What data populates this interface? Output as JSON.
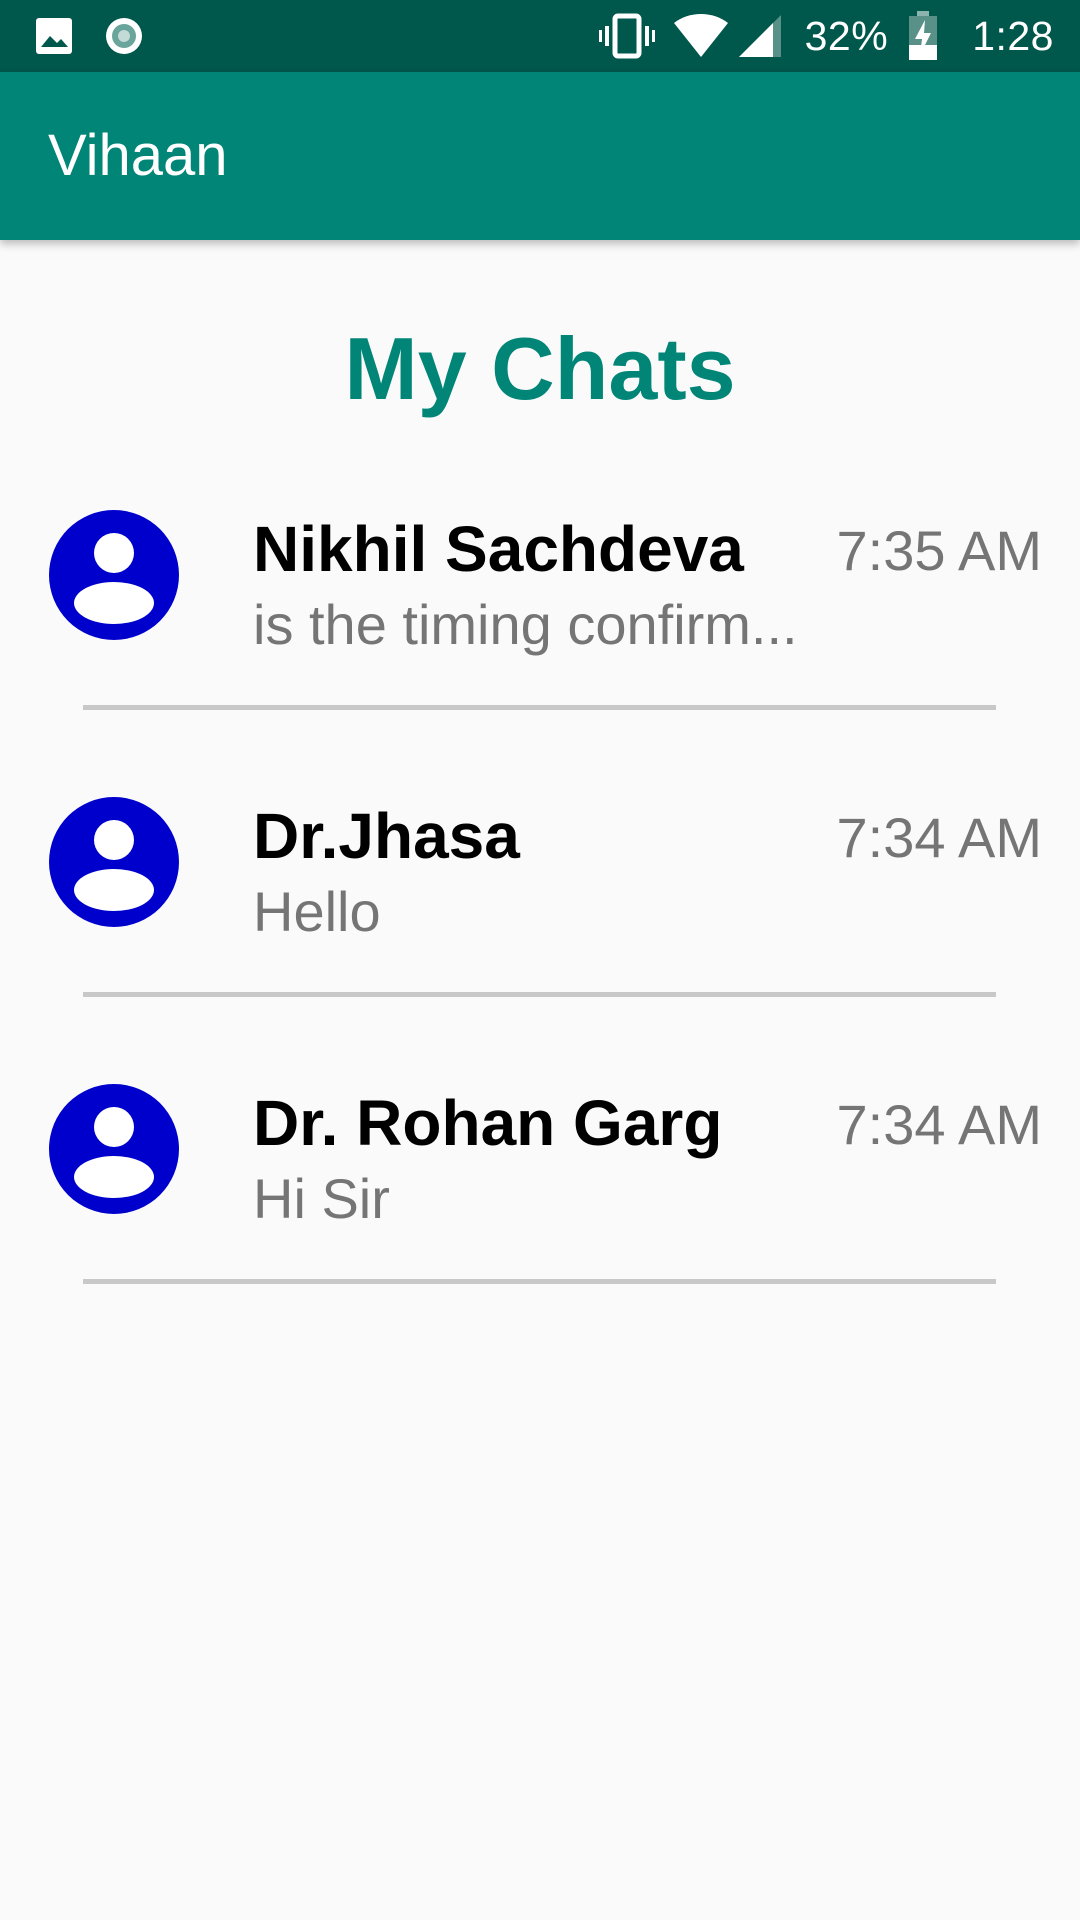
{
  "status_bar": {
    "icons_left": [
      "image-icon",
      "record-icon"
    ],
    "icons_right": [
      "vibrate-icon",
      "wifi-icon",
      "cell-signal-icon",
      "battery-charging-icon"
    ],
    "battery": "32%",
    "time": "1:28"
  },
  "app_bar": {
    "title": "Vihaan"
  },
  "heading": "My Chats",
  "chats": [
    {
      "name": "Nikhil Sachdeva",
      "preview": "is the timing confirm...",
      "time": "7:35 AM"
    },
    {
      "name": "Dr.Jhasa",
      "preview": "Hello",
      "time": "7:34 AM"
    },
    {
      "name": "Dr. Rohan Garg",
      "preview": "Hi Sir",
      "time": "7:34 AM"
    }
  ],
  "colors": {
    "status_bar": "#00574b",
    "primary": "#008577",
    "avatar": "#0000cc",
    "divider": "#c8c8c8",
    "secondary_text": "#757575",
    "background": "#fafafa"
  }
}
